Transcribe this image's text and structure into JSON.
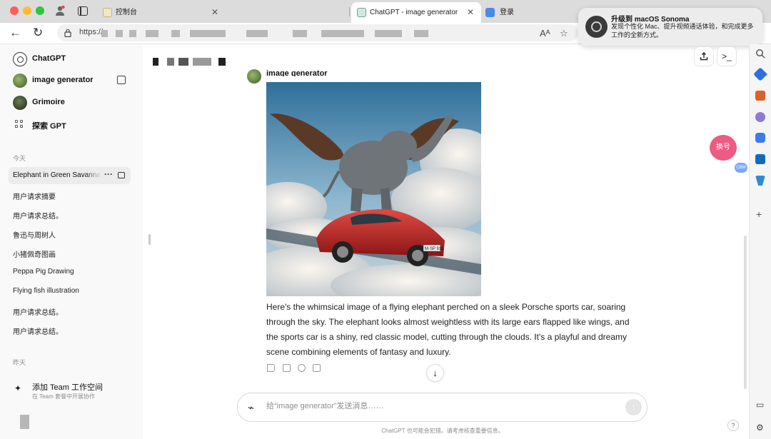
{
  "browser": {
    "tabs": [
      {
        "title": "控制台"
      },
      {
        "title": "ChatGPT - image generator"
      },
      {
        "title": "登录"
      }
    ],
    "url_prefix": "https://"
  },
  "notification": {
    "title": "升级到 macOS Sonoma",
    "body": "发现个性化 Mac、提升视频通话体验，和完成更多工作的全新方式。"
  },
  "sidebar": {
    "gpts": [
      {
        "label": "ChatGPT",
        "icon": "chatgpt-logo"
      },
      {
        "label": "image generator",
        "icon": "image-generator-avatar"
      },
      {
        "label": "Grimoire",
        "icon": "grimoire-avatar"
      },
      {
        "label": "探索 GPT",
        "icon": "explore-grid-icon"
      }
    ],
    "section_today": "今天",
    "active_chat": "Elephant in Green Savanna",
    "history_today": [
      "用户请求摘要",
      "用户请求总结。",
      "鲁迅与周树人",
      "小猪佩奇图画",
      "Peppa Pig Drawing",
      "Flying fish illustration",
      "用户请求总结。",
      "用户请求总结。"
    ],
    "section_yesterday": "昨天",
    "team": {
      "title": "添加 Team 工作空间",
      "subtitle": "在 Team 套餐中开展协作"
    }
  },
  "chat": {
    "bot_name": "image generator",
    "reply": "Here's the whimsical image of a flying elephant perched on a sleek Porsche sports car, soaring through the sky. The elephant looks almost weightless with its large ears flapped like wings, and the sports car is a shiny, red classic model, cutting through the clouds. It's a playful and dreamy scene combining elements of fantasy and luxury.",
    "image_plate": "M·SP 911"
  },
  "composer": {
    "placeholder": "给“image generator”发送消息……"
  },
  "disclaimer": "ChatGPT 也可能会犯错。请考虑核查重要信息。",
  "floating": {
    "switch_label": "换号",
    "badge": "CBM",
    "help": "?"
  },
  "colors": {
    "accent_pink": "#ee5a83",
    "sidebar_bg": "#f9f9f9",
    "active_tab": "#ffffff"
  }
}
